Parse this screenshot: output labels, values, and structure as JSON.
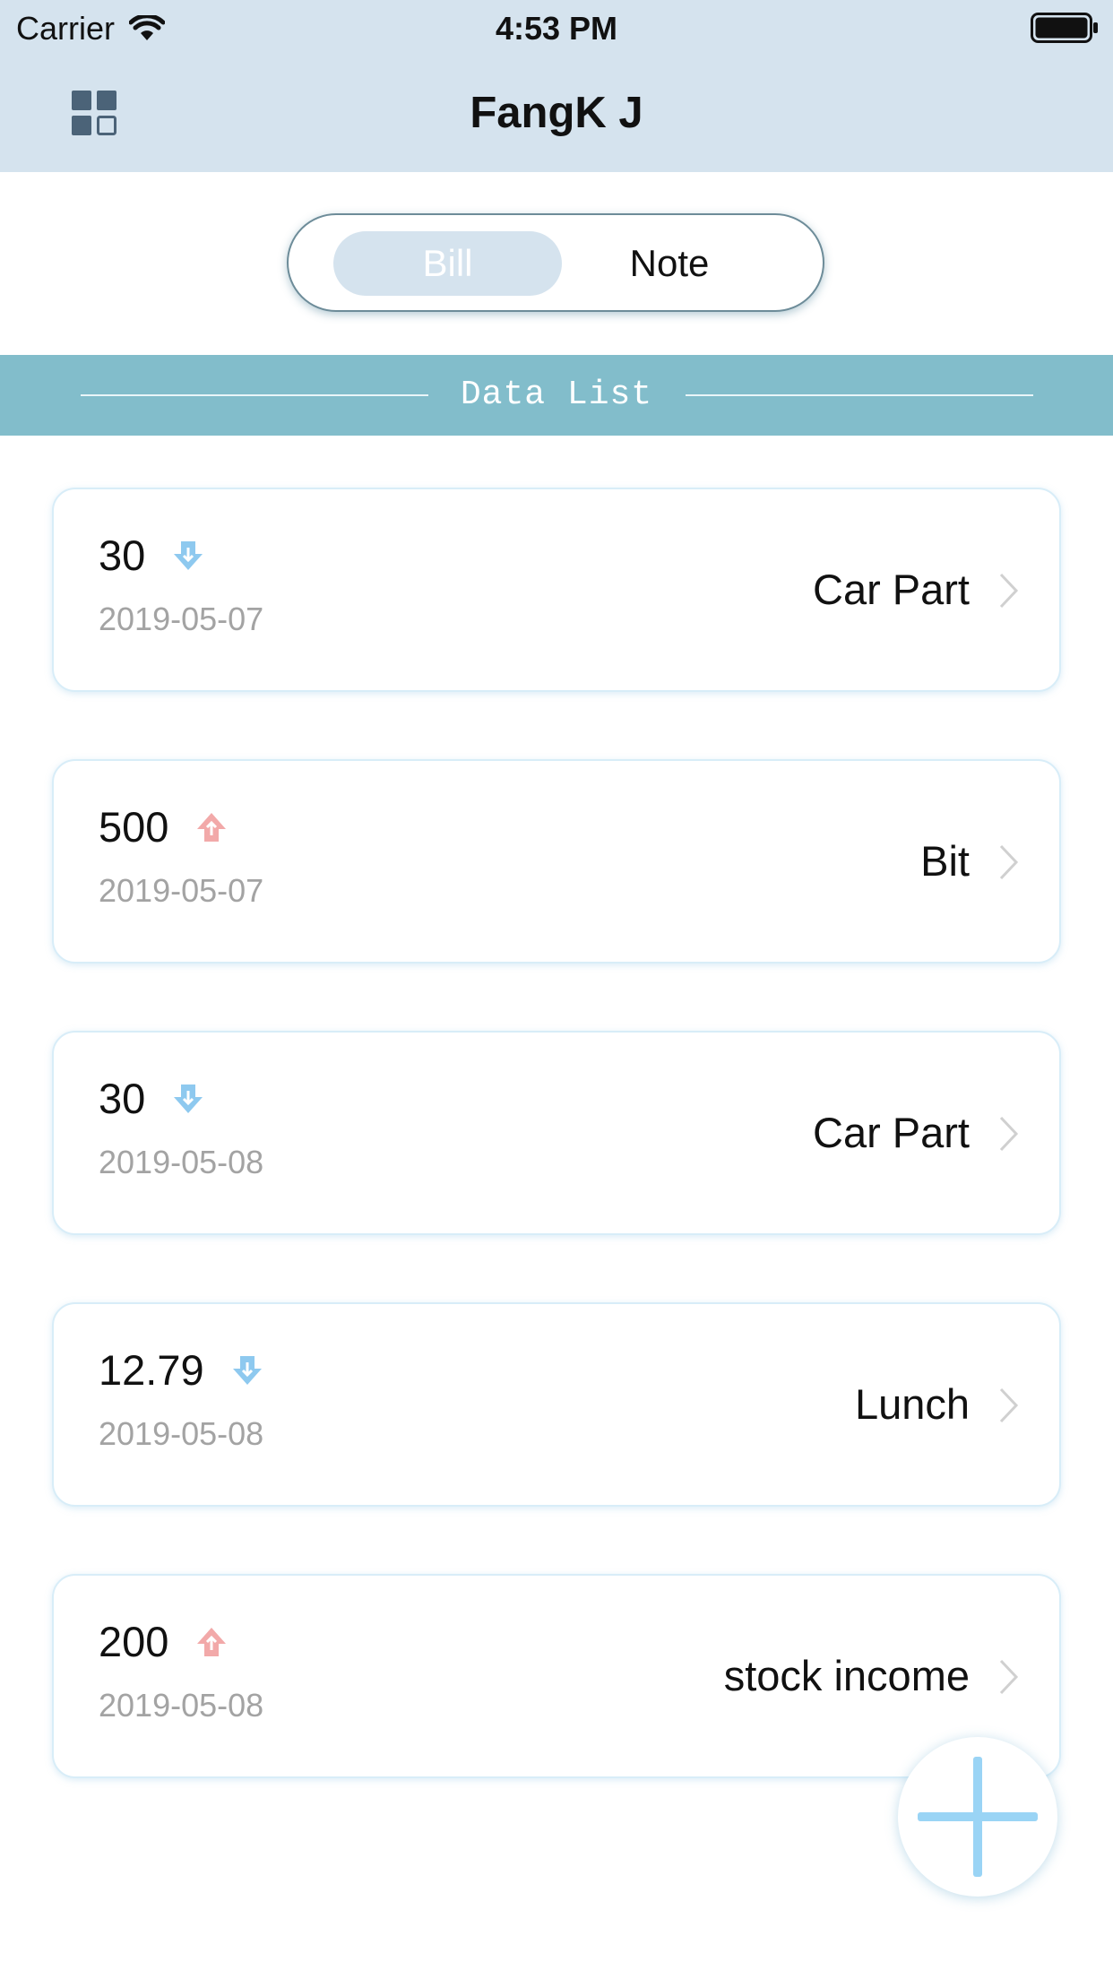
{
  "status_bar": {
    "carrier": "Carrier",
    "time": "4:53 PM"
  },
  "nav": {
    "title": "FangK J",
    "menu_icon": "grid-icon"
  },
  "segment": {
    "bill": "Bill",
    "note": "Note",
    "selected": "Bill"
  },
  "section": {
    "title": "Data List"
  },
  "records": [
    {
      "amount": "30",
      "direction": "expense",
      "date": "2019-05-07",
      "category": "Car Part"
    },
    {
      "amount": "500",
      "direction": "income",
      "date": "2019-05-07",
      "category": "Bit"
    },
    {
      "amount": "30",
      "direction": "expense",
      "date": "2019-05-08",
      "category": "Car Part"
    },
    {
      "amount": "12.79",
      "direction": "expense",
      "date": "2019-05-08",
      "category": "Lunch"
    },
    {
      "amount": "200",
      "direction": "income",
      "date": "2019-05-08",
      "category": "stock income"
    }
  ],
  "colors": {
    "expense": "#8ec9ef",
    "income": "#f2a9a9",
    "header": "#d5e3ee",
    "band": "#82bdcb"
  }
}
